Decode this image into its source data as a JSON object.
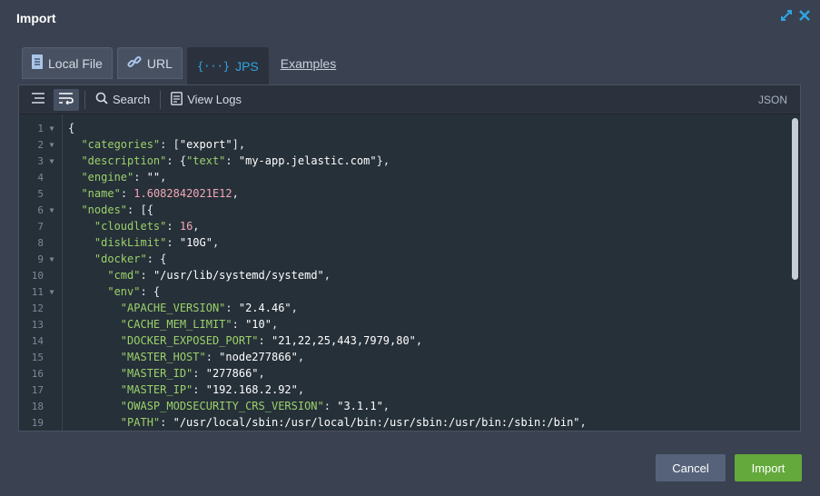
{
  "window": {
    "title": "Import"
  },
  "tabs": [
    {
      "label": "Local File",
      "icon": "file-icon"
    },
    {
      "label": "URL",
      "icon": "link-icon"
    },
    {
      "label": "JPS",
      "icon": "json-braces-icon",
      "active": true
    },
    {
      "label": "Examples"
    }
  ],
  "toolbar": {
    "search": "Search",
    "view_logs": "View Logs",
    "format": "JSON"
  },
  "editor": {
    "lines": [
      {
        "num": "1",
        "fold": true,
        "html": "{"
      },
      {
        "num": "2",
        "fold": true,
        "html": "  <span class=\"k\">\"categories\"</span>: [<span class=\"s\">\"export\"</span>],"
      },
      {
        "num": "3",
        "fold": true,
        "html": "  <span class=\"k\">\"description\"</span>: {<span class=\"k\">\"text\"</span>: <span class=\"s\">\"my-app.jelastic.com\"</span>},"
      },
      {
        "num": "4",
        "fold": false,
        "html": "  <span class=\"k\">\"engine\"</span>: <span class=\"s\">\"\"</span>,"
      },
      {
        "num": "5",
        "fold": false,
        "html": "  <span class=\"k\">\"name\"</span>: <span class=\"n\">1.6082842021E12</span>,"
      },
      {
        "num": "6",
        "fold": true,
        "html": "  <span class=\"k\">\"nodes\"</span>: [{"
      },
      {
        "num": "7",
        "fold": false,
        "html": "    <span class=\"k\">\"cloudlets\"</span>: <span class=\"n\">16</span>,"
      },
      {
        "num": "8",
        "fold": false,
        "html": "    <span class=\"k\">\"diskLimit\"</span>: <span class=\"s\">\"10G\"</span>,"
      },
      {
        "num": "9",
        "fold": true,
        "html": "    <span class=\"k\">\"docker\"</span>: {"
      },
      {
        "num": "10",
        "fold": false,
        "html": "      <span class=\"k\">\"cmd\"</span>: <span class=\"s\">\"/usr/lib/systemd/systemd\"</span>,"
      },
      {
        "num": "11",
        "fold": true,
        "html": "      <span class=\"k\">\"env\"</span>: {"
      },
      {
        "num": "12",
        "fold": false,
        "html": "        <span class=\"k\">\"APACHE_VERSION\"</span>: <span class=\"s\">\"2.4.46\"</span>,"
      },
      {
        "num": "13",
        "fold": false,
        "html": "        <span class=\"k\">\"CACHE_MEM_LIMIT\"</span>: <span class=\"s\">\"10\"</span>,"
      },
      {
        "num": "14",
        "fold": false,
        "html": "        <span class=\"k\">\"DOCKER_EXPOSED_PORT\"</span>: <span class=\"s\">\"21,22,25,443,7979,80\"</span>,"
      },
      {
        "num": "15",
        "fold": false,
        "html": "        <span class=\"k\">\"MASTER_HOST\"</span>: <span class=\"s\">\"node277866\"</span>,"
      },
      {
        "num": "16",
        "fold": false,
        "html": "        <span class=\"k\">\"MASTER_ID\"</span>: <span class=\"s\">\"277866\"</span>,"
      },
      {
        "num": "17",
        "fold": false,
        "html": "        <span class=\"k\">\"MASTER_IP\"</span>: <span class=\"s\">\"192.168.2.92\"</span>,"
      },
      {
        "num": "18",
        "fold": false,
        "html": "        <span class=\"k\">\"OWASP_MODSECURITY_CRS_VERSION\"</span>: <span class=\"s\">\"3.1.1\"</span>,"
      },
      {
        "num": "19",
        "fold": false,
        "html": "        <span class=\"k\">\"PATH\"</span>: <span class=\"s\">\"/usr/local/sbin:/usr/local/bin:/usr/sbin:/usr/bin:/sbin:/bin\"</span>,"
      }
    ]
  },
  "buttons": {
    "cancel": "Cancel",
    "import": "Import"
  }
}
